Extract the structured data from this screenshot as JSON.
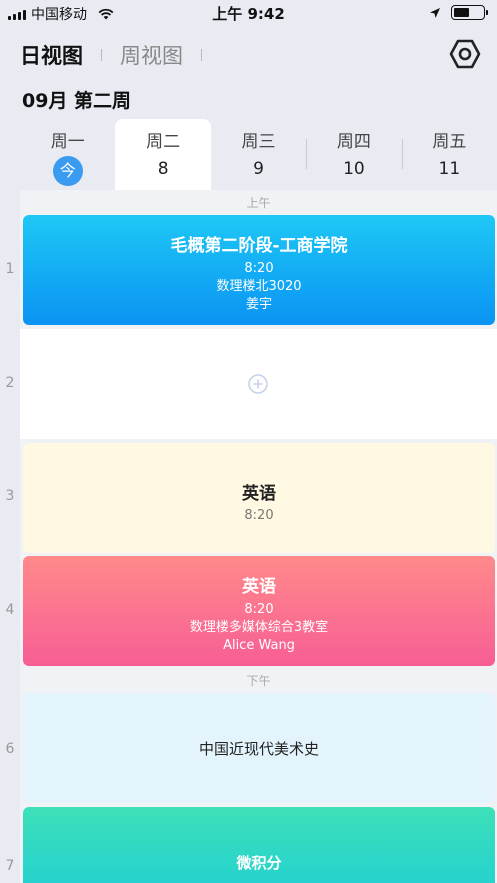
{
  "status_bar": {
    "carrier": "中国移动",
    "time": "上午 9:42",
    "icons": [
      "signal-icon",
      "wifi-icon",
      "location-icon",
      "battery-icon"
    ],
    "battery_level": 0.55
  },
  "header": {
    "view_tabs": [
      {
        "label": "日视图",
        "active": true
      },
      {
        "label": "周视图",
        "active": false
      }
    ],
    "settings_icon": "hexagon-gear-icon"
  },
  "week_title": "09月 第二周",
  "days": [
    {
      "name": "周一",
      "num": "今",
      "today": true
    },
    {
      "name": "周二",
      "num": "8",
      "selected": true
    },
    {
      "name": "周三",
      "num": "9"
    },
    {
      "name": "周四",
      "num": "10"
    },
    {
      "name": "周五",
      "num": "11"
    }
  ],
  "sections": {
    "morning": "上午",
    "afternoon": "下午"
  },
  "periods": [
    "1",
    "2",
    "3",
    "4",
    "6",
    "7"
  ],
  "courses": [
    {
      "title": "毛概第二阶段-工商学院",
      "time": "8:20",
      "location": "数理楼北3020",
      "teacher": "姜宇",
      "color_top": "#1ec8f5",
      "color_bottom": "#0a93f3",
      "text_color": "#ffffff"
    },
    {
      "title": "英语",
      "time": "8:20",
      "color": "#fff9e3",
      "text_color": "#222222"
    },
    {
      "title": "英语",
      "time": "8:20",
      "location": "数理楼多媒体综合3教室",
      "teacher": "Alice Wang",
      "color_top": "#ff8a8a",
      "color_bottom": "#f75e95",
      "text_color": "#ffffff"
    },
    {
      "title": "中国近现代美术史",
      "color": "#e4f4fc",
      "text_color": "#222222"
    },
    {
      "title": "微积分",
      "color_top": "#3de0b8",
      "color_bottom": "#22d0d2",
      "text_color": "#ffffff"
    }
  ],
  "empty_slot_icon": "add-circle-icon"
}
